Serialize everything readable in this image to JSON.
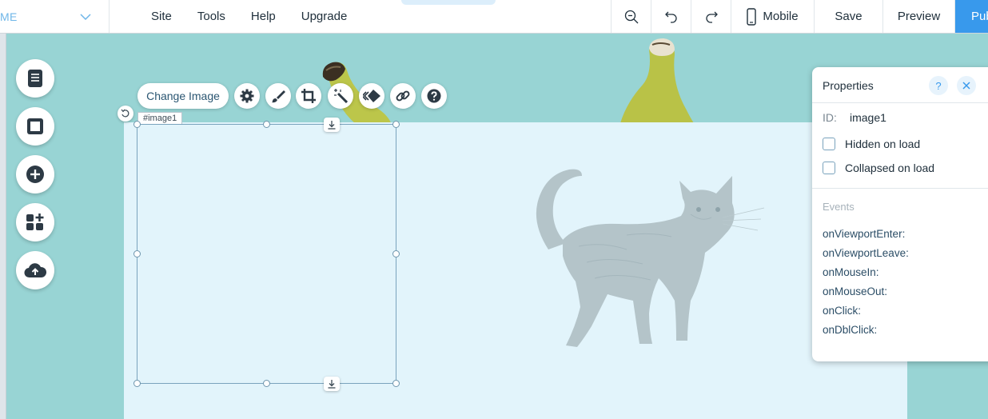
{
  "topbar": {
    "page_name": "ME",
    "menu": [
      "Site",
      "Tools",
      "Help",
      "Upgrade"
    ],
    "mobile_label": "Mobile",
    "save_label": "Save",
    "preview_label": "Preview",
    "publish_label": "Pub"
  },
  "toolbar": {
    "change_image_label": "Change Image"
  },
  "element": {
    "tag": "#image1"
  },
  "properties": {
    "title": "Properties",
    "help_glyph": "?",
    "id_label": "ID:",
    "id_value": "image1",
    "hidden_on_load": "Hidden on load",
    "collapsed_on_load": "Collapsed on load",
    "events_title": "Events",
    "events": [
      "onViewportEnter:",
      "onViewportLeave:",
      "onMouseIn:",
      "onMouseOut:",
      "onClick:",
      "onDblClick:"
    ]
  },
  "colors": {
    "canvas_bg": "#98d4d4",
    "strip_bg": "#e2f4fb",
    "accent": "#3899ec",
    "text": "#20303c"
  }
}
